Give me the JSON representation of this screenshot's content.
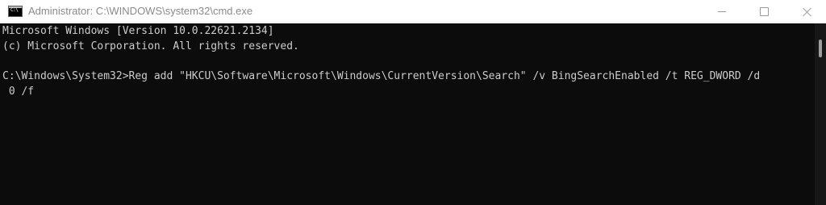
{
  "window": {
    "title": "Administrator: C:\\WINDOWS\\system32\\cmd.exe",
    "icon": "cmd-icon",
    "icon_text": "C:\\"
  },
  "console": {
    "lines": [
      "Microsoft Windows [Version 10.0.22621.2134]",
      "(c) Microsoft Corporation. All rights reserved.",
      "",
      "C:\\Windows\\System32>Reg add \"HKCU\\Software\\Microsoft\\Windows\\CurrentVersion\\Search\" /v BingSearchEnabled /t REG_DWORD /d",
      " 0 /f"
    ]
  },
  "colors": {
    "console_background": "#0c0c0c",
    "console_text": "#cccccc",
    "titlebar_background": "#ffffff",
    "title_text": "#8a8a8a"
  }
}
